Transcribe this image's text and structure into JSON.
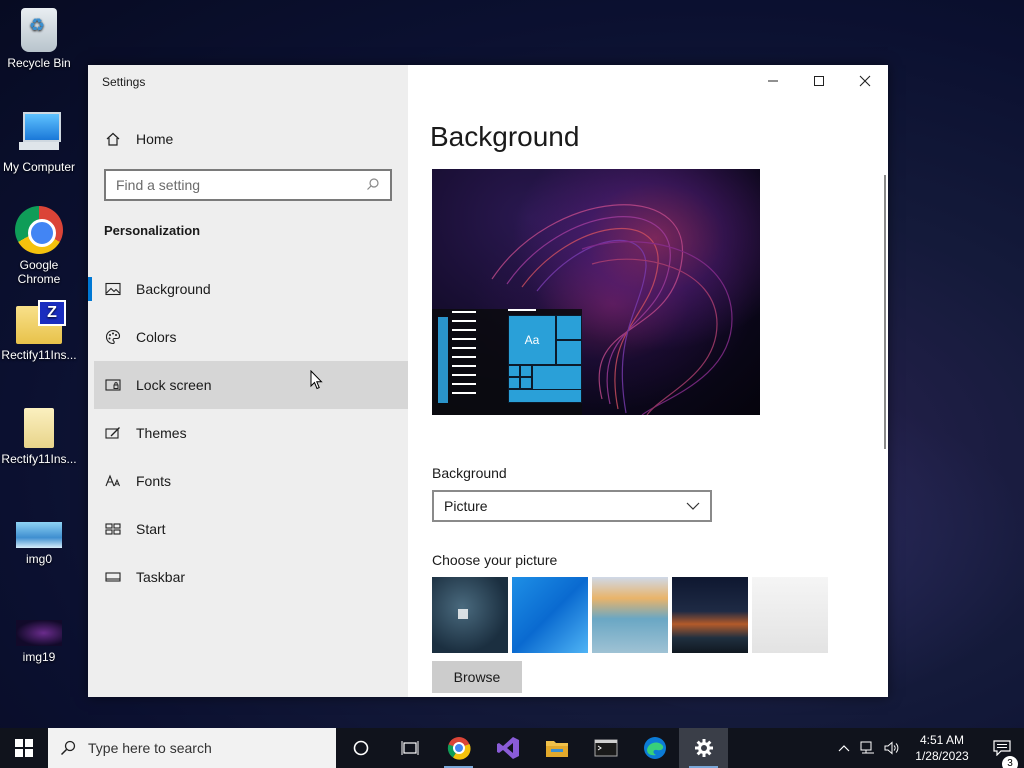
{
  "desktop": {
    "icons": [
      {
        "label": "Recycle Bin"
      },
      {
        "label": "My Computer"
      },
      {
        "label": "Google\nChrome"
      },
      {
        "label": "Rectify11Ins..."
      },
      {
        "label": "Rectify11Ins..."
      },
      {
        "label": "img0"
      },
      {
        "label": "img19"
      }
    ]
  },
  "window": {
    "title": "Settings",
    "controls": {
      "minimize_icon": "minimize-icon",
      "maximize_icon": "maximize-icon",
      "close_icon": "close-icon"
    }
  },
  "sidebar": {
    "home_label": "Home",
    "search_placeholder": "Find a setting",
    "section_title": "Personalization",
    "items": [
      {
        "label": "Background",
        "icon": "picture-icon",
        "selected": true
      },
      {
        "label": "Colors",
        "icon": "palette-icon"
      },
      {
        "label": "Lock screen",
        "icon": "lock-screen-icon",
        "hovered": true
      },
      {
        "label": "Themes",
        "icon": "themes-icon"
      },
      {
        "label": "Fonts",
        "icon": "fonts-icon"
      },
      {
        "label": "Start",
        "icon": "start-icon"
      },
      {
        "label": "Taskbar",
        "icon": "taskbar-icon"
      }
    ]
  },
  "main": {
    "page_title": "Background",
    "preview": {
      "tile_text": "Aa"
    },
    "background_label": "Background",
    "background_value": "Picture",
    "choose_picture_label": "Choose your picture",
    "browse_label": "Browse"
  },
  "taskbar": {
    "search_placeholder": "Type here to search",
    "apps": [
      "cortana-icon",
      "task-view-icon",
      "chrome-icon",
      "visual-studio-icon",
      "file-explorer-icon",
      "terminal-icon",
      "edge-icon",
      "settings-icon"
    ],
    "time": "4:51 AM",
    "date": "1/28/2023",
    "notification_count": "3"
  },
  "colors": {
    "accent": "#0078d4",
    "taskbar": "#10131c",
    "sidebar": "#eeeeee"
  }
}
